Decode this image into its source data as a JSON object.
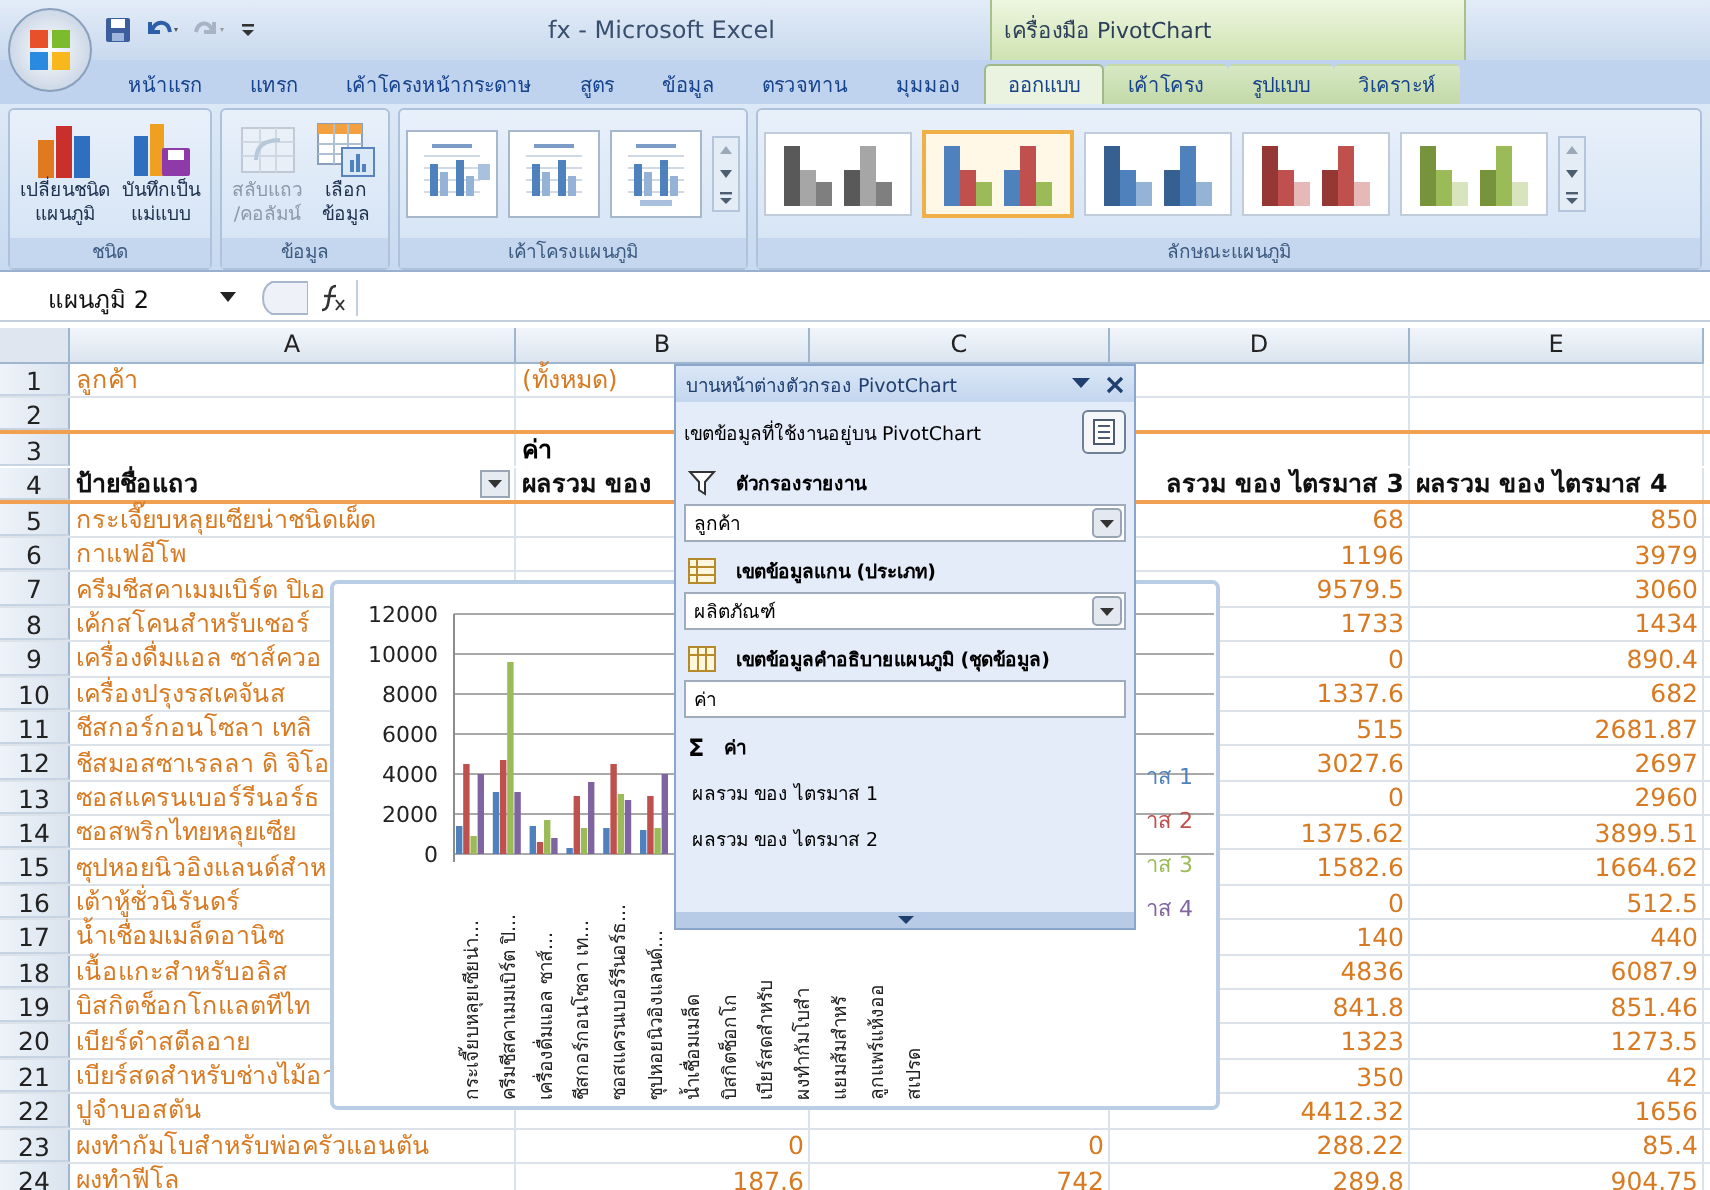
{
  "window": {
    "title": "fx - Microsoft Excel",
    "context_group": "เครื่องมือ PivotChart"
  },
  "tabs": [
    {
      "label": "หน้าแรก",
      "selected": false,
      "kind": "normal"
    },
    {
      "label": "แทรก",
      "selected": false,
      "kind": "normal"
    },
    {
      "label": "เค้าโครงหน้ากระดาษ",
      "selected": false,
      "kind": "normal"
    },
    {
      "label": "สูตร",
      "selected": false,
      "kind": "normal"
    },
    {
      "label": "ข้อมูล",
      "selected": false,
      "kind": "normal"
    },
    {
      "label": "ตรวจทาน",
      "selected": false,
      "kind": "normal"
    },
    {
      "label": "มุมมอง",
      "selected": false,
      "kind": "normal"
    },
    {
      "label": "ออกแบบ",
      "selected": true,
      "kind": "contextual"
    },
    {
      "label": "เค้าโครง",
      "selected": false,
      "kind": "contextual"
    },
    {
      "label": "รูปแบบ",
      "selected": false,
      "kind": "contextual"
    },
    {
      "label": "วิเคราะห์",
      "selected": false,
      "kind": "contextual"
    }
  ],
  "ribbon": {
    "groups": [
      {
        "label": "ชนิด",
        "kind": "buttons",
        "buttons": [
          {
            "kind": "chart-type",
            "lines": [
              "เปลี่ยนชนิด",
              "แผนภูมิ"
            ],
            "disabled": false
          },
          {
            "kind": "save-template",
            "lines": [
              "บันทึกเป็น",
              "แม่แบบ"
            ],
            "disabled": false
          }
        ]
      },
      {
        "label": "ข้อมูล",
        "kind": "buttons",
        "buttons": [
          {
            "kind": "switch",
            "lines": [
              "สลับแถว",
              "/คอลัมน์"
            ],
            "disabled": true
          },
          {
            "kind": "select-data",
            "lines": [
              "เลือก",
              "ข้อมูล"
            ],
            "disabled": false
          }
        ]
      },
      {
        "label": "เค้าโครงแผนภูมิ",
        "kind": "layouts"
      },
      {
        "label": "ลักษณะแผนภูมิ",
        "kind": "styles",
        "styles": [
          {
            "kind": "grey",
            "selected": false
          },
          {
            "kind": "multi",
            "selected": true
          },
          {
            "kind": "blue",
            "selected": false
          },
          {
            "kind": "red",
            "selected": false
          },
          {
            "kind": "green",
            "selected": false
          }
        ]
      }
    ]
  },
  "formula_bar": {
    "name_box": "แผนภูมิ 2"
  },
  "sheet": {
    "columns": [
      "A",
      "B",
      "C",
      "D",
      "E"
    ],
    "rows": [
      {
        "number": "1",
        "kind": "filter",
        "cells": {
          "a": "ลูกค้า",
          "b": "(ทั้งหมด)"
        }
      },
      {
        "number": "2",
        "kind": "blank",
        "cells": {}
      },
      {
        "number": "3",
        "kind": "header",
        "cells": {
          "b": "ค่า"
        }
      },
      {
        "number": "4",
        "kind": "labels",
        "cells": {
          "a": "ป้ายชื่อแถว",
          "b": "ผลรวม ของ",
          "d": "ลรวม ของ ไตรมาส 3",
          "e": "ผลรวม ของ ไตรมาส 4"
        }
      },
      {
        "number": "5",
        "kind": "data",
        "cells": {
          "a": "กระเจี๊ยบหลุยเซียน่าชนิดเผ็ด",
          "d": "68",
          "e": "850"
        }
      },
      {
        "number": "6",
        "kind": "data",
        "cells": {
          "a": "กาแฟอีโพ",
          "d": "1196",
          "e": "3979"
        }
      },
      {
        "number": "7",
        "kind": "data",
        "cells": {
          "a": "ครีมชีสคาเมมเบิร์ต ปิเอ",
          "d": "9579.5",
          "e": "3060"
        }
      },
      {
        "number": "8",
        "kind": "data",
        "cells": {
          "a": "เค้กสโคนสำหรับเชอร์",
          "d": "1733",
          "e": "1434"
        }
      },
      {
        "number": "9",
        "kind": "data",
        "cells": {
          "a": "เครื่องดื่มแอล ซาส์ควอ",
          "d": "0",
          "e": "890.4"
        }
      },
      {
        "number": "10",
        "kind": "data",
        "cells": {
          "a": "เครื่องปรุงรสเคจันส",
          "d": "1337.6",
          "e": "682"
        }
      },
      {
        "number": "11",
        "kind": "data",
        "cells": {
          "a": "ชีสกอร์กอนโซลา เทลิ",
          "d": "515",
          "e": "2681.87"
        }
      },
      {
        "number": "12",
        "kind": "data",
        "cells": {
          "a": "ชีสมอสซาเรลลา ดิ จิโอ",
          "d": "3027.6",
          "e": "2697"
        }
      },
      {
        "number": "13",
        "kind": "data",
        "cells": {
          "a": "ซอสแครนเบอร์รีนอร์ธ",
          "d": "0",
          "e": "2960"
        }
      },
      {
        "number": "14",
        "kind": "data",
        "cells": {
          "a": "ซอสพริกไทยหลุยเซีย",
          "d": "1375.62",
          "e": "3899.51"
        }
      },
      {
        "number": "15",
        "kind": "data",
        "cells": {
          "a": "ซุปหอยนิวอิงแลนด์สำห",
          "d": "1582.6",
          "e": "1664.62"
        }
      },
      {
        "number": "16",
        "kind": "data",
        "cells": {
          "a": "เต้าหู้ชั่วนิรันดร์",
          "d": "0",
          "e": "512.5"
        }
      },
      {
        "number": "17",
        "kind": "data",
        "cells": {
          "a": "น้ำเชื่อมเมล็ดอานิซ",
          "d": "140",
          "e": "440"
        }
      },
      {
        "number": "18",
        "kind": "data",
        "cells": {
          "a": "เนื้อแกะสำหรับอลิส",
          "d": "4836",
          "e": "6087.9"
        }
      },
      {
        "number": "19",
        "kind": "data",
        "cells": {
          "a": "บิสกิตช็อกโกแลตทีไท",
          "d": "841.8",
          "e": "851.46"
        }
      },
      {
        "number": "20",
        "kind": "data",
        "cells": {
          "a": "เบียร์ดำสตีลอาย",
          "d": "1323",
          "e": "1273.5"
        }
      },
      {
        "number": "21",
        "kind": "data",
        "cells": {
          "a": "เบียร์สดสำหรับช่างไม้อา",
          "d": "350",
          "e": "42"
        }
      },
      {
        "number": "22",
        "kind": "data",
        "cells": {
          "a": "ปูจำบอสตัน",
          "d": "4412.32",
          "e": "1656"
        }
      },
      {
        "number": "23",
        "kind": "data",
        "cells": {
          "a": "ผงทำกัมโบสำหรับพ่อครัวแอนตัน",
          "b": "0",
          "c": "0",
          "d": "288.22",
          "e": "85.4"
        }
      },
      {
        "number": "24",
        "kind": "data",
        "cells": {
          "a": "ผงทำฟีโล",
          "b": "187.6",
          "c": "742",
          "d": "289.8",
          "e": "904.75"
        }
      }
    ]
  },
  "chart": {
    "chart_data": {
      "type": "bar",
      "categories": [
        "กระเจี๊ยบหลุยเซียน่า...",
        "ครีมชีสคาเมมเบิร์ต ปิ...",
        "เครื่องดื่มแอล ซาส์...",
        "ชีสกอร์กอนโซลา เท...",
        "ซอสแครนเบอร์รีนอร์ธ...",
        "ซุปหอยนิวอิงแลนด์...",
        "น้ำเชื่อมเมล็ด",
        "บิสกิตช็อกโก",
        "เบียร์สดสำหรับ",
        "ผงทำกัมโบสำ",
        "แยมส้มสำหรั",
        "ลูกแพร์แห้งออ",
        "สเปรด"
      ],
      "ylim": [
        0,
        12000
      ],
      "grid": true,
      "yticks": [
        0,
        2000,
        4000,
        6000,
        8000,
        10000,
        12000
      ],
      "series": [
        {
          "name": "าส 1",
          "color": "#4f81bd",
          "values": [
            1400,
            3100,
            1400,
            300,
            1300,
            1200,
            null,
            null,
            null,
            null,
            null,
            null,
            null
          ]
        },
        {
          "name": "าส 2",
          "color": "#c0504d",
          "values": [
            4500,
            4700,
            600,
            2900,
            4500,
            2900,
            null,
            null,
            null,
            null,
            null,
            null,
            null
          ]
        },
        {
          "name": "าส 3",
          "color": "#9bbb59",
          "values": [
            900,
            9600,
            1700,
            1300,
            3000,
            1300,
            null,
            null,
            null,
            null,
            null,
            null,
            null
          ]
        },
        {
          "name": "าส 4",
          "color": "#8064a2",
          "values": [
            4000,
            3100,
            800,
            3600,
            2700,
            4000,
            null,
            null,
            null,
            null,
            null,
            null,
            null
          ]
        }
      ]
    }
  },
  "filter_pane": {
    "title": "บานหน้าต่างตัวกรอง PivotChart",
    "subtitle": "เขตข้อมูลที่ใช้งานอยู่บน PivotChart",
    "sections": [
      {
        "kind": "filter",
        "label": "ตัวกรองรายงาน",
        "value": "ลูกค้า",
        "dropdown": true
      },
      {
        "kind": "axis",
        "label": "เขตข้อมูลแกน (ประเภท)",
        "value": "ผลิตภัณฑ์",
        "dropdown": true
      },
      {
        "kind": "legend",
        "label": "เขตข้อมูลคำอธิบายแผนภูมิ (ชุดข้อมูล)",
        "value": "ค่า",
        "dropdown": false
      }
    ],
    "values_icon": "Σ",
    "values_label": "ค่า",
    "values": [
      "ผลรวม ของ ไตรมาส 1",
      "ผลรวม ของ ไตรมาส 2"
    ]
  }
}
